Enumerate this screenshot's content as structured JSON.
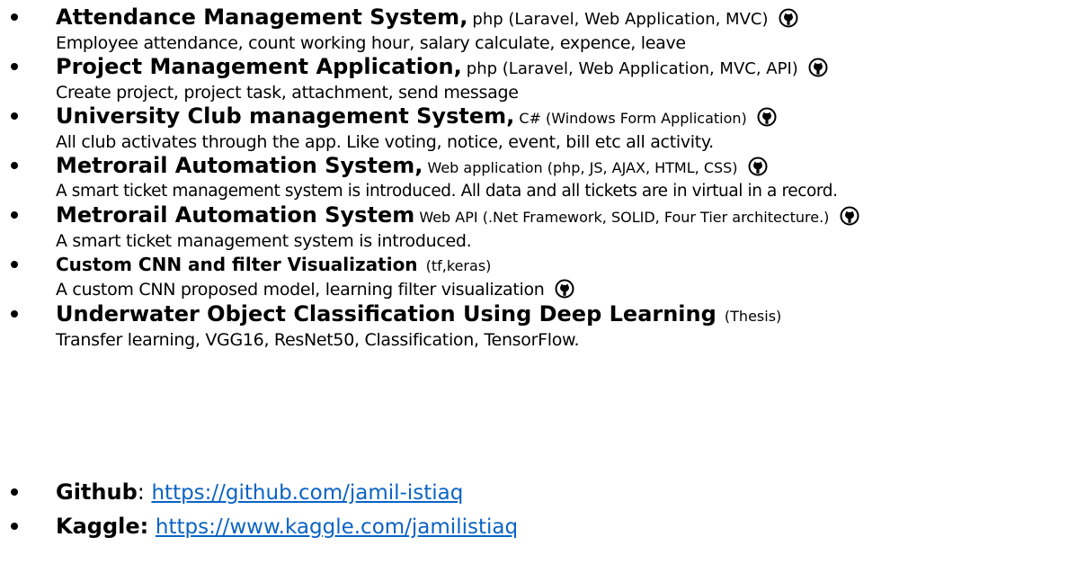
{
  "projects": [
    {
      "title": "Attendance Management System,",
      "tech": "php (Laravel, Web Application, MVC)",
      "description": "Employee attendance, count working hour, salary calculate, expence, leave",
      "icon": "github-icon"
    },
    {
      "title": "Project Management Application,",
      "tech": "php (Laravel, Web Application, MVC, API)",
      "description": "Create project, project task, attachment, send message",
      "icon": "github-icon"
    },
    {
      "title": "University Club management System,",
      "tech": "C# (Windows Form Application)",
      "description": "All club activates through the app. Like voting, notice, event, bill etc all activity.",
      "icon": "github-icon"
    },
    {
      "title": "Metrorail Automation System,",
      "tech": "Web application (php, JS, AJAX, HTML, CSS)",
      "description": "A smart ticket management system is introduced. All data and all tickets are in virtual in a record.",
      "icon": "github-icon"
    },
    {
      "title": "Metrorail Automation System",
      "tech": "Web API (.Net Framework, SOLID, Four Tier architecture.)",
      "description": "A smart ticket management system is introduced.",
      "icon": "github-icon"
    },
    {
      "title": "Custom CNN and filter Visualization",
      "tech": "(tf,keras)",
      "description": "A custom CNN proposed model, learning filter visualization",
      "icon": "github-icon"
    },
    {
      "title": "Underwater Object Classification Using Deep Learning",
      "tech": "(Thesis)",
      "description": "Transfer learning, VGG16, ResNet50, Classification, TensorFlow."
    }
  ],
  "links": [
    {
      "label": "Github",
      "separator": ": ",
      "url": "https://github.com/jamil-istiaq"
    },
    {
      "label": "Kaggle:",
      "separator": " ",
      "url": "https://www.kaggle.com/jamilistiaq"
    }
  ],
  "colors": {
    "text": "#000000",
    "link": "#0b63c5",
    "icon": "#000000"
  }
}
